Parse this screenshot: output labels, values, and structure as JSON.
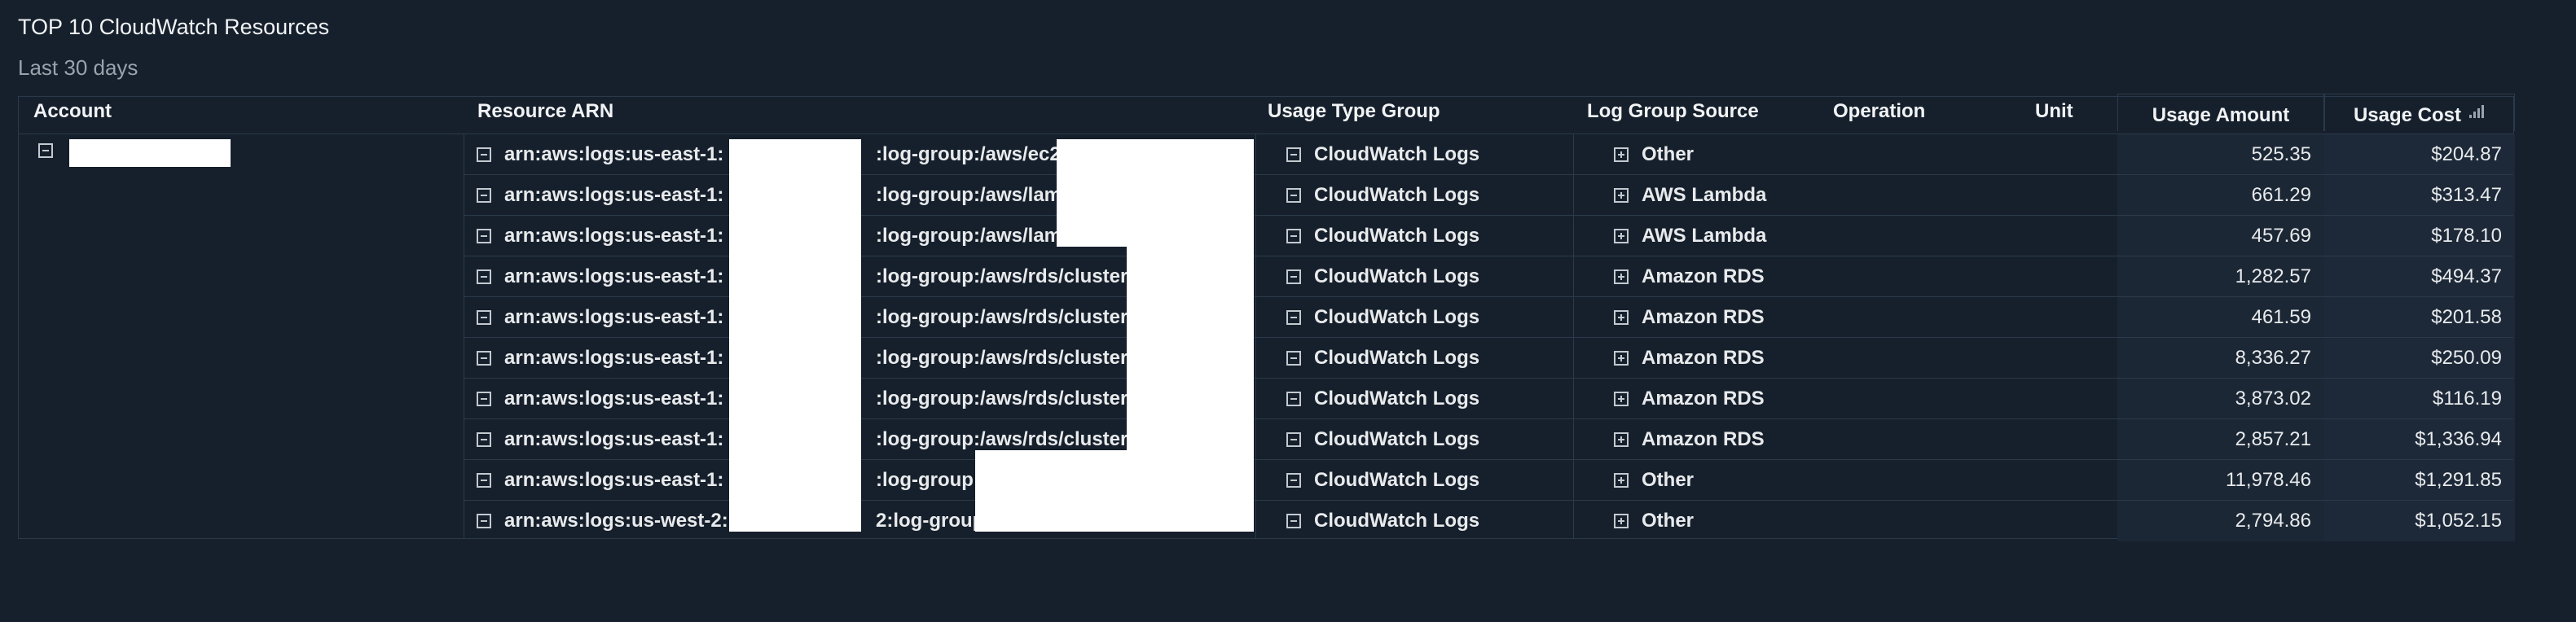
{
  "widget": {
    "title": "TOP 10 CloudWatch Resources",
    "subtitle": "Last 30 days"
  },
  "columns": {
    "account": "Account",
    "resource_arn": "Resource ARN",
    "usage_type_group": "Usage Type Group",
    "log_group_source": "Log Group Source",
    "operation": "Operation",
    "unit": "Unit",
    "usage_amount": "Usage Amount",
    "usage_cost": "Usage Cost"
  },
  "rows": [
    {
      "arn": "arn:aws:logs:us-east-1:",
      "arn_suffix": ":log-group:/aws/ec2/",
      "usage_type_group": "CloudWatch Logs",
      "log_group_source": "Other",
      "usage_amount": "525.35",
      "usage_cost": "$204.87"
    },
    {
      "arn": "arn:aws:logs:us-east-1:",
      "arn_suffix": ":log-group:/aws/lam",
      "usage_type_group": "CloudWatch Logs",
      "log_group_source": "AWS Lambda",
      "usage_amount": "661.29",
      "usage_cost": "$313.47"
    },
    {
      "arn": "arn:aws:logs:us-east-1:",
      "arn_suffix": ":log-group:/aws/lam",
      "usage_type_group": "CloudWatch Logs",
      "log_group_source": "AWS Lambda",
      "usage_amount": "457.69",
      "usage_cost": "$178.10"
    },
    {
      "arn": "arn:aws:logs:us-east-1:",
      "arn_suffix": ":log-group:/aws/rds/cluster/",
      "usage_type_group": "CloudWatch Logs",
      "log_group_source": "Amazon RDS",
      "usage_amount": "1,282.57",
      "usage_cost": "$494.37"
    },
    {
      "arn": "arn:aws:logs:us-east-1:",
      "arn_suffix": ":log-group:/aws/rds/cluster/",
      "usage_type_group": "CloudWatch Logs",
      "log_group_source": "Amazon RDS",
      "usage_amount": "461.59",
      "usage_cost": "$201.58"
    },
    {
      "arn": "arn:aws:logs:us-east-1:",
      "arn_suffix": ":log-group:/aws/rds/cluster/",
      "usage_type_group": "CloudWatch Logs",
      "log_group_source": "Amazon RDS",
      "usage_amount": "8,336.27",
      "usage_cost": "$250.09"
    },
    {
      "arn": "arn:aws:logs:us-east-1:",
      "arn_suffix": ":log-group:/aws/rds/cluster/",
      "usage_type_group": "CloudWatch Logs",
      "log_group_source": "Amazon RDS",
      "usage_amount": "3,873.02",
      "usage_cost": "$116.19"
    },
    {
      "arn": "arn:aws:logs:us-east-1:",
      "arn_suffix": ":log-group:/aws/rds/cluster/",
      "usage_type_group": "CloudWatch Logs",
      "log_group_source": "Amazon RDS",
      "usage_amount": "2,857.21",
      "usage_cost": "$1,336.94"
    },
    {
      "arn": "arn:aws:logs:us-east-1:",
      "arn_suffix": ":log-group:/",
      "usage_type_group": "CloudWatch Logs",
      "log_group_source": "Other",
      "usage_amount": "11,978.46",
      "usage_cost": "$1,291.85"
    },
    {
      "arn": "arn:aws:logs:us-west-2:",
      "arn_suffix": "2:log-group:/",
      "usage_type_group": "CloudWatch Logs",
      "log_group_source": "Other",
      "usage_amount": "2,794.86",
      "usage_cost": "$1,052.15"
    }
  ],
  "icons": {
    "collapse": "minus-square-icon",
    "expand": "plus-square-icon",
    "sort": "sort-icon"
  },
  "colors": {
    "background": "#16202c",
    "grid": "#2b3a4a",
    "text": "#e8eaec",
    "muted": "#9aa3ad"
  }
}
